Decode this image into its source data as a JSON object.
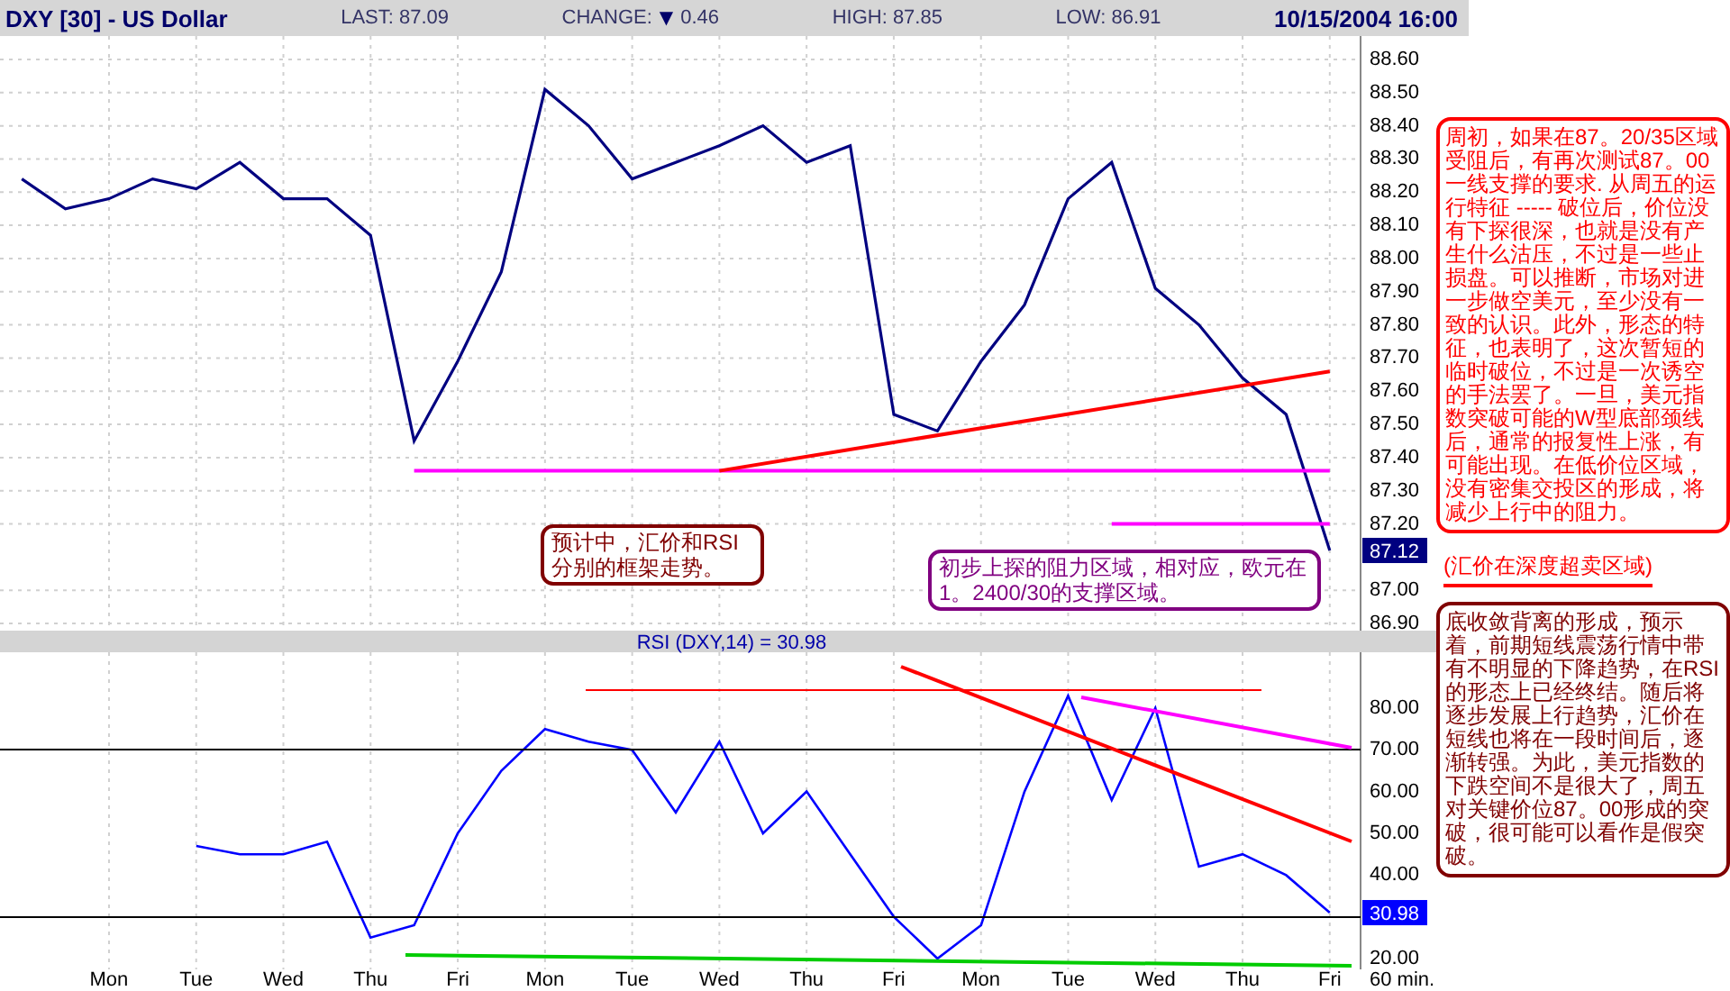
{
  "header": {
    "symbol": "DXY [30] - US Dollar",
    "last": "LAST: 87.09",
    "change_label": "CHANGE:",
    "change_arrow": "▼",
    "change": "0.46",
    "high": "HIGH: 87.85",
    "low": "LOW: 86.91",
    "datetime": "10/15/2004 16:00"
  },
  "price_panel": {
    "current_price": "87.12",
    "chart_data": {
      "type": "line",
      "grid": true,
      "categories": [
        null,
        null,
        null,
        null,
        null,
        null,
        null,
        null,
        null,
        null,
        null,
        null,
        null,
        null,
        null,
        null,
        null,
        null,
        null,
        null,
        null,
        null,
        null,
        null,
        null,
        null,
        null,
        null,
        null,
        null,
        null
      ],
      "ylim": [
        86.9,
        88.6
      ],
      "yticks": [
        {
          "value": 88.6,
          "label": "88.60"
        },
        {
          "value": 88.5,
          "label": "88.50"
        },
        {
          "value": 88.4,
          "label": "88.40"
        },
        {
          "value": 88.3,
          "label": "88.30"
        },
        {
          "value": 88.2,
          "label": "88.20"
        },
        {
          "value": 88.1,
          "label": "88.10"
        },
        {
          "value": 88.0,
          "label": "88.00"
        },
        {
          "value": 87.9,
          "label": "87.90"
        },
        {
          "value": 87.8,
          "label": "87.80"
        },
        {
          "value": 87.7,
          "label": "87.70"
        },
        {
          "value": 87.6,
          "label": "87.60"
        },
        {
          "value": 87.5,
          "label": "87.50"
        },
        {
          "value": 87.4,
          "label": "87.40"
        },
        {
          "value": 87.3,
          "label": "87.30"
        },
        {
          "value": 87.2,
          "label": "87.20"
        },
        {
          "value": 87.0,
          "label": "87.00"
        },
        {
          "value": 86.9,
          "label": "86.90"
        }
      ],
      "series": [
        {
          "color": "#000080",
          "values": [
            88.24,
            88.15,
            88.18,
            88.24,
            88.21,
            88.29,
            88.18,
            88.18,
            88.07,
            87.45,
            87.69,
            87.96,
            88.51,
            88.4,
            88.24,
            88.29,
            88.34,
            88.4,
            88.29,
            88.34,
            87.53,
            87.48,
            87.69,
            87.86,
            88.18,
            88.29,
            87.91,
            87.8,
            87.64,
            87.53,
            87.12
          ]
        },
        {
          "color": "#ff00ff",
          "values": [
            null,
            null,
            null,
            null,
            null,
            null,
            null,
            null,
            null,
            87.36,
            null,
            null,
            null,
            null,
            null,
            null,
            null,
            null,
            null,
            null,
            null,
            null,
            null,
            null,
            null,
            null,
            null,
            null,
            null,
            null,
            87.36
          ]
        },
        {
          "color": "#ff0000",
          "values": [
            null,
            null,
            null,
            null,
            null,
            null,
            null,
            null,
            null,
            null,
            null,
            null,
            null,
            null,
            null,
            null,
            87.36,
            null,
            null,
            null,
            null,
            null,
            null,
            null,
            null,
            null,
            null,
            null,
            null,
            null,
            87.66
          ]
        },
        {
          "color": "#ff00ff",
          "values": [
            null,
            null,
            null,
            null,
            null,
            null,
            null,
            null,
            null,
            null,
            null,
            null,
            null,
            null,
            null,
            null,
            null,
            null,
            null,
            null,
            null,
            null,
            null,
            null,
            null,
            87.2,
            null,
            null,
            null,
            null,
            87.2
          ]
        }
      ]
    }
  },
  "rsi_panel": {
    "current_value": "30.98",
    "chart_data": {
      "type": "line",
      "title": "RSI (DXY,14) = 30.98",
      "grid": true,
      "ylim": [
        17.4,
        93.4
      ],
      "categories": [
        null,
        null,
        "Mon",
        null,
        "Tue",
        null,
        "Wed",
        null,
        "Thu",
        null,
        "Fri",
        null,
        "Mon",
        null,
        "Tue",
        null,
        "Wed",
        null,
        "Thu",
        null,
        "Fri",
        null,
        "Mon",
        null,
        "Tue",
        null,
        "Wed",
        null,
        "Thu",
        null,
        "Fri"
      ],
      "yticks": [
        {
          "value": 80,
          "label": "80.00"
        },
        {
          "value": 70,
          "label": "70.00"
        },
        {
          "value": 60,
          "label": "60.00"
        },
        {
          "value": 50,
          "label": "50.00"
        },
        {
          "value": 40,
          "label": "40.00"
        },
        {
          "value": 20,
          "label": "20.00"
        }
      ],
      "series": [
        {
          "color": "#0000ff",
          "values": [
            null,
            null,
            null,
            null,
            47,
            45,
            45,
            48,
            25,
            28,
            50,
            65,
            75,
            72,
            70,
            55,
            72,
            50,
            60,
            45,
            30,
            20,
            28,
            60,
            83,
            58,
            80,
            42,
            45,
            40,
            31
          ]
        }
      ]
    }
  },
  "interval_label": "60 min.",
  "notes": [
    {
      "kind": "box",
      "color": "#ff0000",
      "text": "周初，如果在87。20/35区域受阻后，有再次测试87。00一线支撑的要求. 从周五的运行特征 ----- 破位后，价位没有下探很深，也就是没有产生什么沽压，不过是一些止损盘。可以推断，市场对进一步做空美元，至少没有一致的认识。此外，形态的特征，也表明了，这次暂短的临时破位，不过是一次诱空的手法罢了。一旦，美元指数突破可能的W型底部颈线后，通常的报复性上涨，有可能出现。在低价位区域，没有密集交投区的形成，将减少上行中的阻力。"
    },
    {
      "kind": "underlined",
      "color": "#ff0000",
      "text": "(汇价在深度超卖区域)"
    },
    {
      "kind": "box",
      "color": "#800000",
      "text": "底收敛背离的形成，预示着，前期短线震荡行情中带有不明显的下降趋势，在RSI 的形态上已经终结。随后将逐步发展上行趋势，汇价在短线也将在一段时间后，逐渐转强。为此，美元指数的下跌空间不是很大了，周五对关键价位87。00形成的突破，很可能可以看作是假突破。"
    }
  ],
  "chart_callouts": [
    {
      "kind": "box",
      "color": "#800000",
      "text": "预计中，汇价和RSI分别的框架走势。"
    },
    {
      "kind": "box",
      "color": "#800080",
      "text": "初步上探的阻力区域，相对应，欧元在1。2400/30的支撑区域。"
    }
  ]
}
